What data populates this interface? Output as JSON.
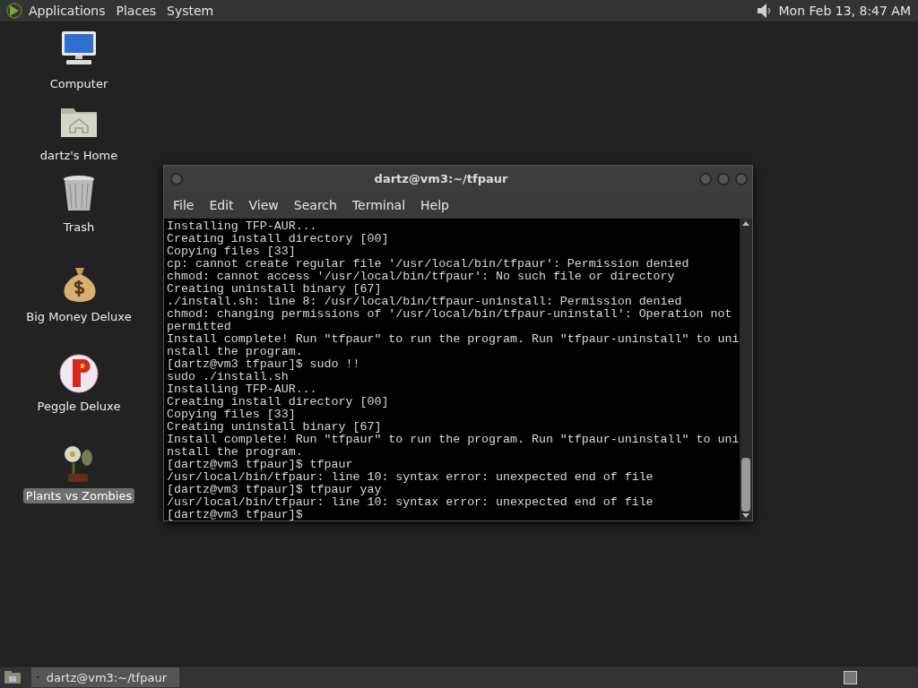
{
  "top_panel": {
    "menus": [
      "Applications",
      "Places",
      "System"
    ],
    "clock": "Mon Feb 13,  8:47 AM"
  },
  "desktop_icons": [
    {
      "label": "Computer",
      "kind": "computer",
      "selected": false
    },
    {
      "label": "dartz's Home",
      "kind": "home",
      "selected": false
    },
    {
      "label": "Trash",
      "kind": "trash",
      "selected": false
    },
    {
      "label": "Big Money Deluxe",
      "kind": "moneybag",
      "selected": false
    },
    {
      "label": "Peggle Deluxe",
      "kind": "ball",
      "selected": false
    },
    {
      "label": "Plants vs Zombies",
      "kind": "plant",
      "selected": true
    }
  ],
  "terminal": {
    "title": "dartz@vm3:~/tfpaur",
    "menu": [
      "File",
      "Edit",
      "View",
      "Search",
      "Terminal",
      "Help"
    ],
    "lines": [
      "Installing TFP-AUR...",
      "Creating install directory [00]",
      "Copying files [33]",
      "cp: cannot create regular file '/usr/local/bin/tfpaur': Permission denied",
      "chmod: cannot access '/usr/local/bin/tfpaur': No such file or directory",
      "Creating uninstall binary [67]",
      "./install.sh: line 8: /usr/local/bin/tfpaur-uninstall: Permission denied",
      "chmod: changing permissions of '/usr/local/bin/tfpaur-uninstall': Operation not",
      "permitted",
      "Install complete! Run \"tfpaur\" to run the program. Run \"tfpaur-uninstall\" to uni",
      "nstall the program.",
      "[dartz@vm3 tfpaur]$ sudo !!",
      "sudo ./install.sh",
      "Installing TFP-AUR...",
      "Creating install directory [00]",
      "Copying files [33]",
      "Creating uninstall binary [67]",
      "Install complete! Run \"tfpaur\" to run the program. Run \"tfpaur-uninstall\" to uni",
      "nstall the program.",
      "[dartz@vm3 tfpaur]$ tfpaur",
      "/usr/local/bin/tfpaur: line 10: syntax error: unexpected end of file",
      "[dartz@vm3 tfpaur]$ tfpaur yay",
      "/usr/local/bin/tfpaur: line 10: syntax error: unexpected end of file",
      "[dartz@vm3 tfpaur]$"
    ]
  },
  "taskbar": {
    "tasks": [
      {
        "title": "dartz@vm3:~/tfpaur",
        "selected": true
      }
    ]
  }
}
